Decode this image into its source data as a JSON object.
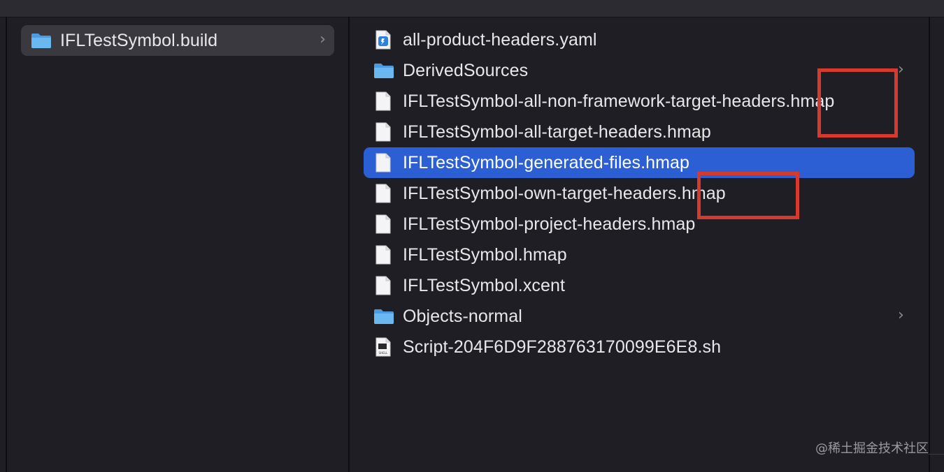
{
  "sidebar": {
    "item": {
      "label": "IFLTestSymbol.build",
      "icon": "folder-icon"
    }
  },
  "files": [
    {
      "label": "all-product-headers.yaml",
      "icon": "yaml-file-icon",
      "has_chevron": false
    },
    {
      "label": "DerivedSources",
      "icon": "folder-icon",
      "has_chevron": true
    },
    {
      "label": "IFLTestSymbol-all-non-framework-target-headers.hmap",
      "icon": "document-icon",
      "has_chevron": false
    },
    {
      "label": "IFLTestSymbol-all-target-headers.hmap",
      "icon": "document-icon",
      "has_chevron": false
    },
    {
      "label": "IFLTestSymbol-generated-files.hmap",
      "icon": "document-icon",
      "has_chevron": false,
      "selected": true
    },
    {
      "label": "IFLTestSymbol-own-target-headers.hmap",
      "icon": "document-icon",
      "has_chevron": false
    },
    {
      "label": "IFLTestSymbol-project-headers.hmap",
      "icon": "document-icon",
      "has_chevron": false
    },
    {
      "label": "IFLTestSymbol.hmap",
      "icon": "document-icon",
      "has_chevron": false
    },
    {
      "label": "IFLTestSymbol.xcent",
      "icon": "document-icon",
      "has_chevron": false
    },
    {
      "label": "Objects-normal",
      "icon": "folder-icon",
      "has_chevron": true
    },
    {
      "label": "Script-204F6D9F288763170099E6E8.sh",
      "icon": "shell-script-icon",
      "has_chevron": false
    }
  ],
  "chevron_glyph": "›",
  "shell_icon_label": "SHELL",
  "watermark": "@稀土掘金技术社区",
  "colors": {
    "selection": "#2c5fd4",
    "folder": "#5aa9e6",
    "annotation": "#d43b2e",
    "background": "#1f1e24"
  }
}
